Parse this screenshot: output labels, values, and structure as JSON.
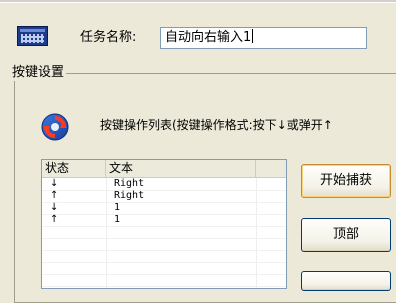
{
  "task": {
    "label": "任务名称:",
    "value": "自动向右输入1"
  },
  "group": {
    "title": "按键设置"
  },
  "ops": {
    "title": "按键操作列表(按键操作格式:按下↓或弹开↑"
  },
  "list": {
    "columns": [
      "状态",
      "文本",
      ""
    ],
    "rows": [
      {
        "status": "↓",
        "text": "Right"
      },
      {
        "status": "↑",
        "text": "Right"
      },
      {
        "status": "↓",
        "text": "1"
      },
      {
        "status": "↑",
        "text": "1"
      }
    ]
  },
  "buttons": {
    "start": "开始捕获",
    "top": "顶部",
    "more": ""
  },
  "icons": {
    "app": "keyboard-icon",
    "ops": "refresh-icon"
  },
  "colors": {
    "window_bg": "#ece9d8",
    "button_border": "#003c74",
    "focus_border": "#c88a2a"
  }
}
